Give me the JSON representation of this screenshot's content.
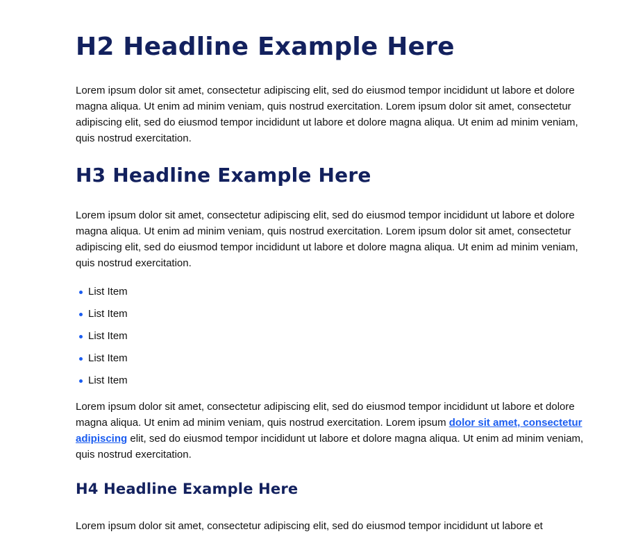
{
  "headings": {
    "h2": "H2 Headline Example Here",
    "h3": "H3 Headline Example Here",
    "h4": "H4 Headline Example Here"
  },
  "paragraphs": {
    "p1": "Lorem ipsum dolor sit amet, consectetur adipiscing elit, sed do eiusmod tempor incididunt ut labore et dolore magna aliqua. Ut enim ad minim veniam, quis nostrud exercitation. Lorem ipsum dolor sit amet, consectetur adipiscing elit, sed do eiusmod tempor incididunt ut labore et dolore magna aliqua. Ut enim ad minim veniam, quis nostrud exercitation.",
    "p2": "Lorem ipsum dolor sit amet, consectetur adipiscing elit, sed do eiusmod tempor incididunt ut labore et dolore magna aliqua. Ut enim ad minim veniam, quis nostrud exercitation. Lorem ipsum dolor sit amet, consectetur adipiscing elit, sed do eiusmod tempor incididunt ut labore et dolore magna aliqua. Ut enim ad minim veniam, quis nostrud exercitation.",
    "p3_before": "Lorem ipsum dolor sit amet, consectetur adipiscing elit, sed do eiusmod tempor incididunt ut labore et dolore magna aliqua. Ut enim ad minim veniam, quis nostrud exercitation. Lorem ipsum ",
    "p3_link": "dolor sit amet, consectetur adipiscing",
    "p3_after": " elit, sed do eiusmod tempor incididunt ut labore et dolore magna aliqua. Ut enim ad minim veniam, quis nostrud exercitation.",
    "p4": "Lorem ipsum dolor sit amet, consectetur adipiscing elit, sed do eiusmod tempor incididunt ut labore et"
  },
  "list": {
    "items": [
      "List Item",
      "List Item",
      "List Item",
      "List Item",
      "List Item"
    ]
  },
  "colors": {
    "heading": "#13215e",
    "link": "#1a5cf0",
    "bullet": "#1a5cf0",
    "text": "#111111"
  }
}
